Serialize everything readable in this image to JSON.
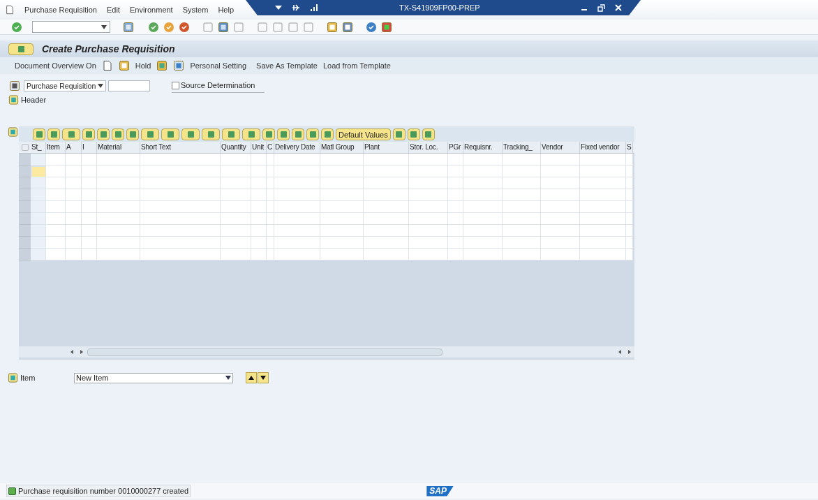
{
  "menu": [
    {
      "label": "Purchase Requisition"
    },
    {
      "label": "Edit"
    },
    {
      "label": "Environment"
    },
    {
      "label": "System"
    },
    {
      "label": "Help"
    }
  ],
  "window": {
    "title": "TX-S41909FP00-PREP"
  },
  "screen_title": "Create Purchase Requisition",
  "app_toolbar": [
    {
      "kind": "text",
      "label": "Document Overview On"
    },
    {
      "kind": "text",
      "label": "Hold"
    },
    {
      "kind": "text",
      "label": "Personal Setting"
    },
    {
      "kind": "text",
      "label": "Save As Template"
    },
    {
      "kind": "text",
      "label": "Load from Template"
    }
  ],
  "document_type": {
    "value": "Purchase Requisition"
  },
  "source_determination": {
    "label": "Source Determination",
    "checked": false
  },
  "header": {
    "label": "Header"
  },
  "grid_toolbar": {
    "default_values": "Default Values"
  },
  "table": {
    "columns": [
      "St_",
      "Item",
      "A",
      "I",
      "Material",
      "Short Text",
      "Quantity",
      "Unit",
      "C",
      "Delivery Date",
      "Matl Group",
      "Plant",
      "Stor. Loc.",
      "PGr",
      "Requisnr.",
      "Tracking_",
      "Vendor",
      "Fixed vendor",
      "S"
    ],
    "rows": [
      {
        "focused": false
      },
      {
        "focused": true
      },
      {
        "focused": false
      },
      {
        "focused": false
      },
      {
        "focused": false
      },
      {
        "focused": false
      },
      {
        "focused": false
      },
      {
        "focused": false
      },
      {
        "focused": false
      }
    ]
  },
  "item": {
    "label": "Item",
    "value": "New Item"
  },
  "status": {
    "message": "Purchase requisition number 0010000277 created"
  },
  "logo": "SAP"
}
